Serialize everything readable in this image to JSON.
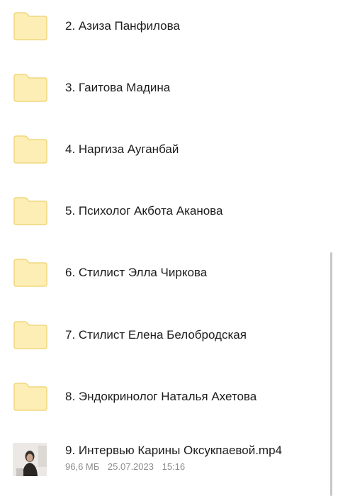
{
  "items": [
    {
      "label": "2. Азиза Панфилова",
      "icon": "folder-icon"
    },
    {
      "label": "3. Гаитова Мадина",
      "icon": "folder-icon"
    },
    {
      "label": "4. Наргиза Ауганбай",
      "icon": "folder-icon"
    },
    {
      "label": "5. Психолог Акбота Аканова",
      "icon": "folder-icon"
    },
    {
      "label": "6. Стилист Элла Чиркова",
      "icon": "folder-icon"
    },
    {
      "label": "7. Стилист Елена Белобродская",
      "icon": "folder-icon"
    },
    {
      "label": "8. Эндокринолог Наталья Ахетова",
      "icon": "folder-icon"
    }
  ],
  "file": {
    "label": "9. Интервью Карины Оксукпаевой.mp4",
    "icon": "video-thumbnail",
    "size": "96,6 МБ",
    "date": "25.07.2023",
    "time": "15:16"
  },
  "colors": {
    "folder_fill": "#fdeeb5",
    "folder_stroke": "#f0d77f",
    "text": "#1c1c1c",
    "meta_text": "#8c8c8c",
    "scrollbar": "#c7c7c7"
  }
}
